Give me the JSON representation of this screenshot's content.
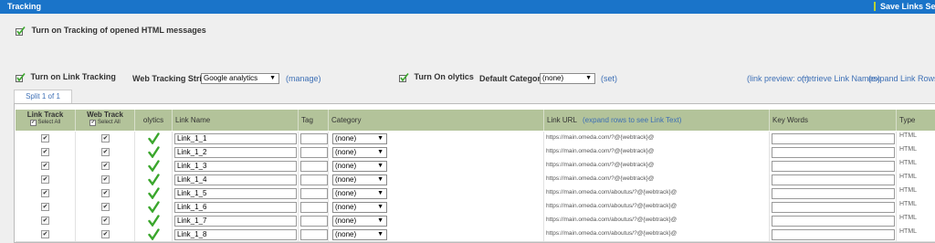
{
  "header": {
    "title": "Tracking",
    "save_label": "Save Links Settings"
  },
  "options": {
    "html_tracking_label": "Turn on Tracking of opened HTML messages",
    "link_tracking_label": "Turn on Link Tracking",
    "web_tracking_label": "Web Tracking String:",
    "web_tracking_value": "Google analytics",
    "manage_link": "(manage)",
    "olytics_label": "Turn On olytics",
    "default_category_label": "Default Category:",
    "default_category_value": "(none)",
    "set_link": "(set)",
    "link_preview": "(link preview: on)",
    "retrieve_names": "(retrieve Link Names)",
    "expand_rows": "(expand Link Rows)"
  },
  "tab": {
    "label": "Split 1 of 1"
  },
  "columns": {
    "link_track": "Link Track",
    "web_track": "Web Track",
    "select_all": "Select All",
    "olytics": "olytics",
    "link_name": "Link Name",
    "tag": "Tag",
    "category": "Category",
    "link_url": "Link URL",
    "expand_text": "(expand rows to see Link Text)",
    "key_words": "Key Words",
    "type": "Type"
  },
  "rows": [
    {
      "name": "Link_1_1",
      "category": "(none)",
      "url": "https://main.omeda.com/?@{webtrack}@",
      "type": "HTML"
    },
    {
      "name": "Link_1_2",
      "category": "(none)",
      "url": "https://main.omeda.com/?@{webtrack}@",
      "type": "HTML"
    },
    {
      "name": "Link_1_3",
      "category": "(none)",
      "url": "https://main.omeda.com/?@{webtrack}@",
      "type": "HTML"
    },
    {
      "name": "Link_1_4",
      "category": "(none)",
      "url": "https://main.omeda.com/?@{webtrack}@",
      "type": "HTML"
    },
    {
      "name": "Link_1_5",
      "category": "(none)",
      "url": "https://main.omeda.com/aboutus/?@{webtrack}@",
      "type": "HTML"
    },
    {
      "name": "Link_1_6",
      "category": "(none)",
      "url": "https://main.omeda.com/aboutus/?@{webtrack}@",
      "type": "HTML"
    },
    {
      "name": "Link_1_7",
      "category": "(none)",
      "url": "https://main.omeda.com/aboutus/?@{webtrack}@",
      "type": "HTML"
    },
    {
      "name": "Link_1_8",
      "category": "(none)",
      "url": "https://main.omeda.com/aboutus/?@{webtrack}@",
      "type": "HTML"
    }
  ],
  "colors": {
    "topbar": "#1a74c9",
    "header_bg": "#b3c39a",
    "link": "#3d6fb5",
    "tick": "#3aa62c"
  },
  "icons": {
    "checked_box": "checkbox-checked-icon",
    "olytics_tick": "green-check-icon",
    "dropdown": "chevron-down-icon"
  }
}
